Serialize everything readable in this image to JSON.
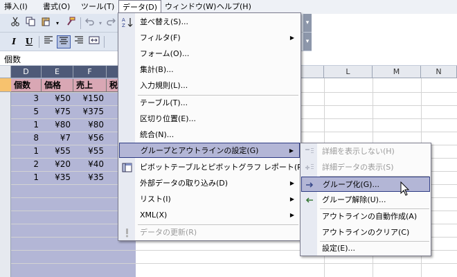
{
  "menubar": {
    "items": [
      {
        "label": "挿入(I)"
      },
      {
        "label": "書式(O)"
      },
      {
        "label": "ツール(T)"
      },
      {
        "label": "データ(D)"
      },
      {
        "label": "ウィンドウ(W)"
      },
      {
        "label": "ヘルプ(H)"
      }
    ],
    "open_index": 3
  },
  "toolbar": {
    "icons": [
      "cut-icon",
      "copy-icon",
      "paste-icon",
      "format-painter-icon",
      "undo-icon",
      "redo-icon"
    ],
    "format_icons": [
      "italic-icon",
      "underline-icon",
      "align-left-icon",
      "align-center-icon",
      "align-right-icon",
      "merge-center-icon"
    ],
    "italic_glyph": "I",
    "underline_glyph": "U"
  },
  "formula_bar": {
    "value": "個数"
  },
  "sheet": {
    "columns": [
      "D",
      "E",
      "F",
      "",
      "",
      "",
      "",
      "",
      "L",
      "M",
      "N"
    ],
    "header_row": [
      "個数",
      "価格",
      "売上",
      "税"
    ],
    "rows": [
      [
        "3",
        "¥50",
        "¥150"
      ],
      [
        "5",
        "¥75",
        "¥375"
      ],
      [
        "1",
        "¥80",
        "¥80"
      ],
      [
        "8",
        "¥7",
        "¥56"
      ],
      [
        "1",
        "¥55",
        "¥55"
      ],
      [
        "2",
        "¥20",
        "¥40"
      ],
      [
        "1",
        "¥35",
        "¥35"
      ]
    ],
    "colors": {
      "selection": "#b3b6d6",
      "header_cell": "#d9a7b4",
      "selected_col_header": "#4e5a78"
    }
  },
  "data_menu": {
    "items": [
      {
        "label": "並べ替え(S)...",
        "icon": "sort-icon"
      },
      {
        "label": "フィルタ(F)",
        "submenu": true
      },
      {
        "label": "フォーム(O)..."
      },
      {
        "label": "集計(B)..."
      },
      {
        "label": "入力規則(L)..."
      },
      {
        "label": "テーブル(T)..."
      },
      {
        "label": "区切り位置(E)..."
      },
      {
        "label": "統合(N)..."
      },
      {
        "label": "グループとアウトラインの設定(G)",
        "submenu": true,
        "highlighted": true
      },
      {
        "label": "ピボットテーブルとピボットグラフ レポート(P)...",
        "icon": "pivot-table-icon"
      },
      {
        "label": "外部データの取り込み(D)",
        "submenu": true
      },
      {
        "label": "リスト(I)",
        "submenu": true
      },
      {
        "label": "XML(X)",
        "submenu": true
      },
      {
        "label": "データの更新(R)",
        "icon": "refresh-icon",
        "disabled": true
      }
    ],
    "submenu_arrow": "▶"
  },
  "outline_submenu": {
    "items": [
      {
        "label": "詳細を表示しない(H)",
        "icon": "hide-detail-icon",
        "disabled": true
      },
      {
        "label": "詳細データの表示(S)",
        "icon": "show-detail-icon",
        "disabled": true
      },
      {
        "label": "グループ化(G)...",
        "icon": "group-icon",
        "highlighted": true
      },
      {
        "label": "グループ解除(U)...",
        "icon": "ungroup-icon"
      },
      {
        "label": "アウトラインの自動作成(A)"
      },
      {
        "label": "アウトラインのクリア(C)"
      },
      {
        "label": "設定(E)..."
      }
    ]
  }
}
